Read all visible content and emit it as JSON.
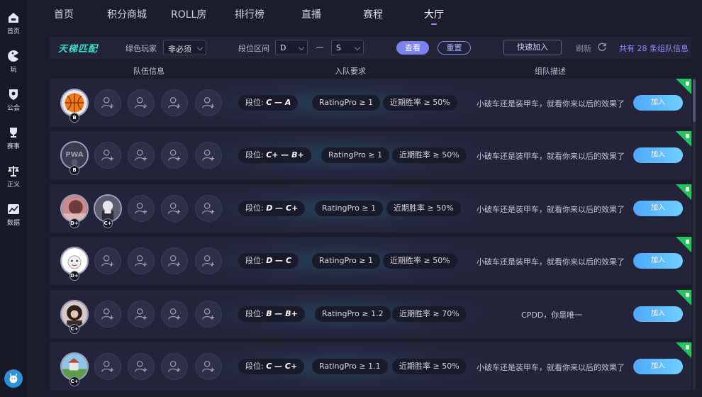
{
  "sidebar": {
    "items": [
      {
        "label": "首页",
        "icon": "home-icon"
      },
      {
        "label": "玩",
        "icon": "pacman-icon"
      },
      {
        "label": "公会",
        "icon": "badge-icon"
      },
      {
        "label": "赛事",
        "icon": "trophy-icon"
      },
      {
        "label": "正义",
        "icon": "scales-icon"
      },
      {
        "label": "数据",
        "icon": "chart-icon"
      }
    ],
    "bottom_icon": "mascot-icon"
  },
  "topnav": {
    "items": [
      "首页",
      "积分商城",
      "ROLL房",
      "排行榜",
      "直播",
      "赛程",
      "大厅"
    ],
    "active": "大厅"
  },
  "filter": {
    "brand": "天梯匹配",
    "green_player_label": "绿色玩家",
    "green_player_value": "非必须",
    "rank_range_label": "段位区间",
    "rank_from": "D",
    "rank_to": "S",
    "search_button": "查看",
    "reset_button": "重置",
    "quick_join_button": "快速加入",
    "refresh_label": "刷新",
    "total_text": "共有 28 条组队信息"
  },
  "columns": {
    "team": "队伍信息",
    "requirement": "入队要求",
    "description": "组队描述"
  },
  "rows": [
    {
      "members": [
        {
          "rank": "B",
          "avatar": "orange-basketball-avatar"
        }
      ],
      "rank_prefix": "段位: ",
      "rank_range": "C — A",
      "rating": "RatingPro ≥ 1",
      "winrate": "近期胜率 ≥ 50%",
      "desc": "小破车还是装甲车，就看你来以后的效果了",
      "join": "加入"
    },
    {
      "members": [
        {
          "rank": "B",
          "avatar": "pwa-logo-avatar"
        }
      ],
      "rank_prefix": "段位: ",
      "rank_range": "C+ — B+",
      "rating": "RatingPro ≥ 1",
      "winrate": "近期胜率 ≥ 50%",
      "desc": "小破车还是装甲车，就看你来以后的效果了",
      "join": "加入"
    },
    {
      "members": [
        {
          "rank": "D+",
          "avatar": "portrait-avatar"
        },
        {
          "rank": "C+",
          "avatar": "character-avatar"
        }
      ],
      "rank_prefix": "段位: ",
      "rank_range": "D — C+",
      "rating": "RatingPro ≥ 1",
      "winrate": "近期胜率 ≥ 50%",
      "desc": "小破车还是装甲车，就看你来以后的效果了",
      "join": "加入"
    },
    {
      "members": [
        {
          "rank": "D+",
          "avatar": "cartoon-avatar"
        }
      ],
      "rank_prefix": "段位: ",
      "rank_range": "D — C",
      "rating": "RatingPro ≥ 1",
      "winrate": "近期胜率 ≥ 50%",
      "desc": "小破车还是装甲车，就看你来以后的效果了",
      "join": "加入"
    },
    {
      "members": [
        {
          "rank": "C+",
          "avatar": "girl-avatar"
        }
      ],
      "rank_prefix": "段位: ",
      "rank_range": "B — B+",
      "rating": "RatingPro ≥ 1.2",
      "winrate": "近期胜率 ≥ 70%",
      "desc": "CPDD，你是唯一",
      "join": "加入"
    },
    {
      "members": [
        {
          "rank": "C+",
          "avatar": "landscape-avatar"
        }
      ],
      "rank_prefix": "段位: ",
      "rank_range": "C — C+",
      "rating": "RatingPro ≥ 1.1",
      "winrate": "近期胜率 ≥ 50%",
      "desc": "小破车还是装甲车，就看你来以后的效果了",
      "join": "加入"
    }
  ],
  "colors": {
    "accent": "#7a82f0",
    "brand": "#35e0c8",
    "join_button": "#4ea7ff",
    "corner_tag": "#22c55e"
  }
}
